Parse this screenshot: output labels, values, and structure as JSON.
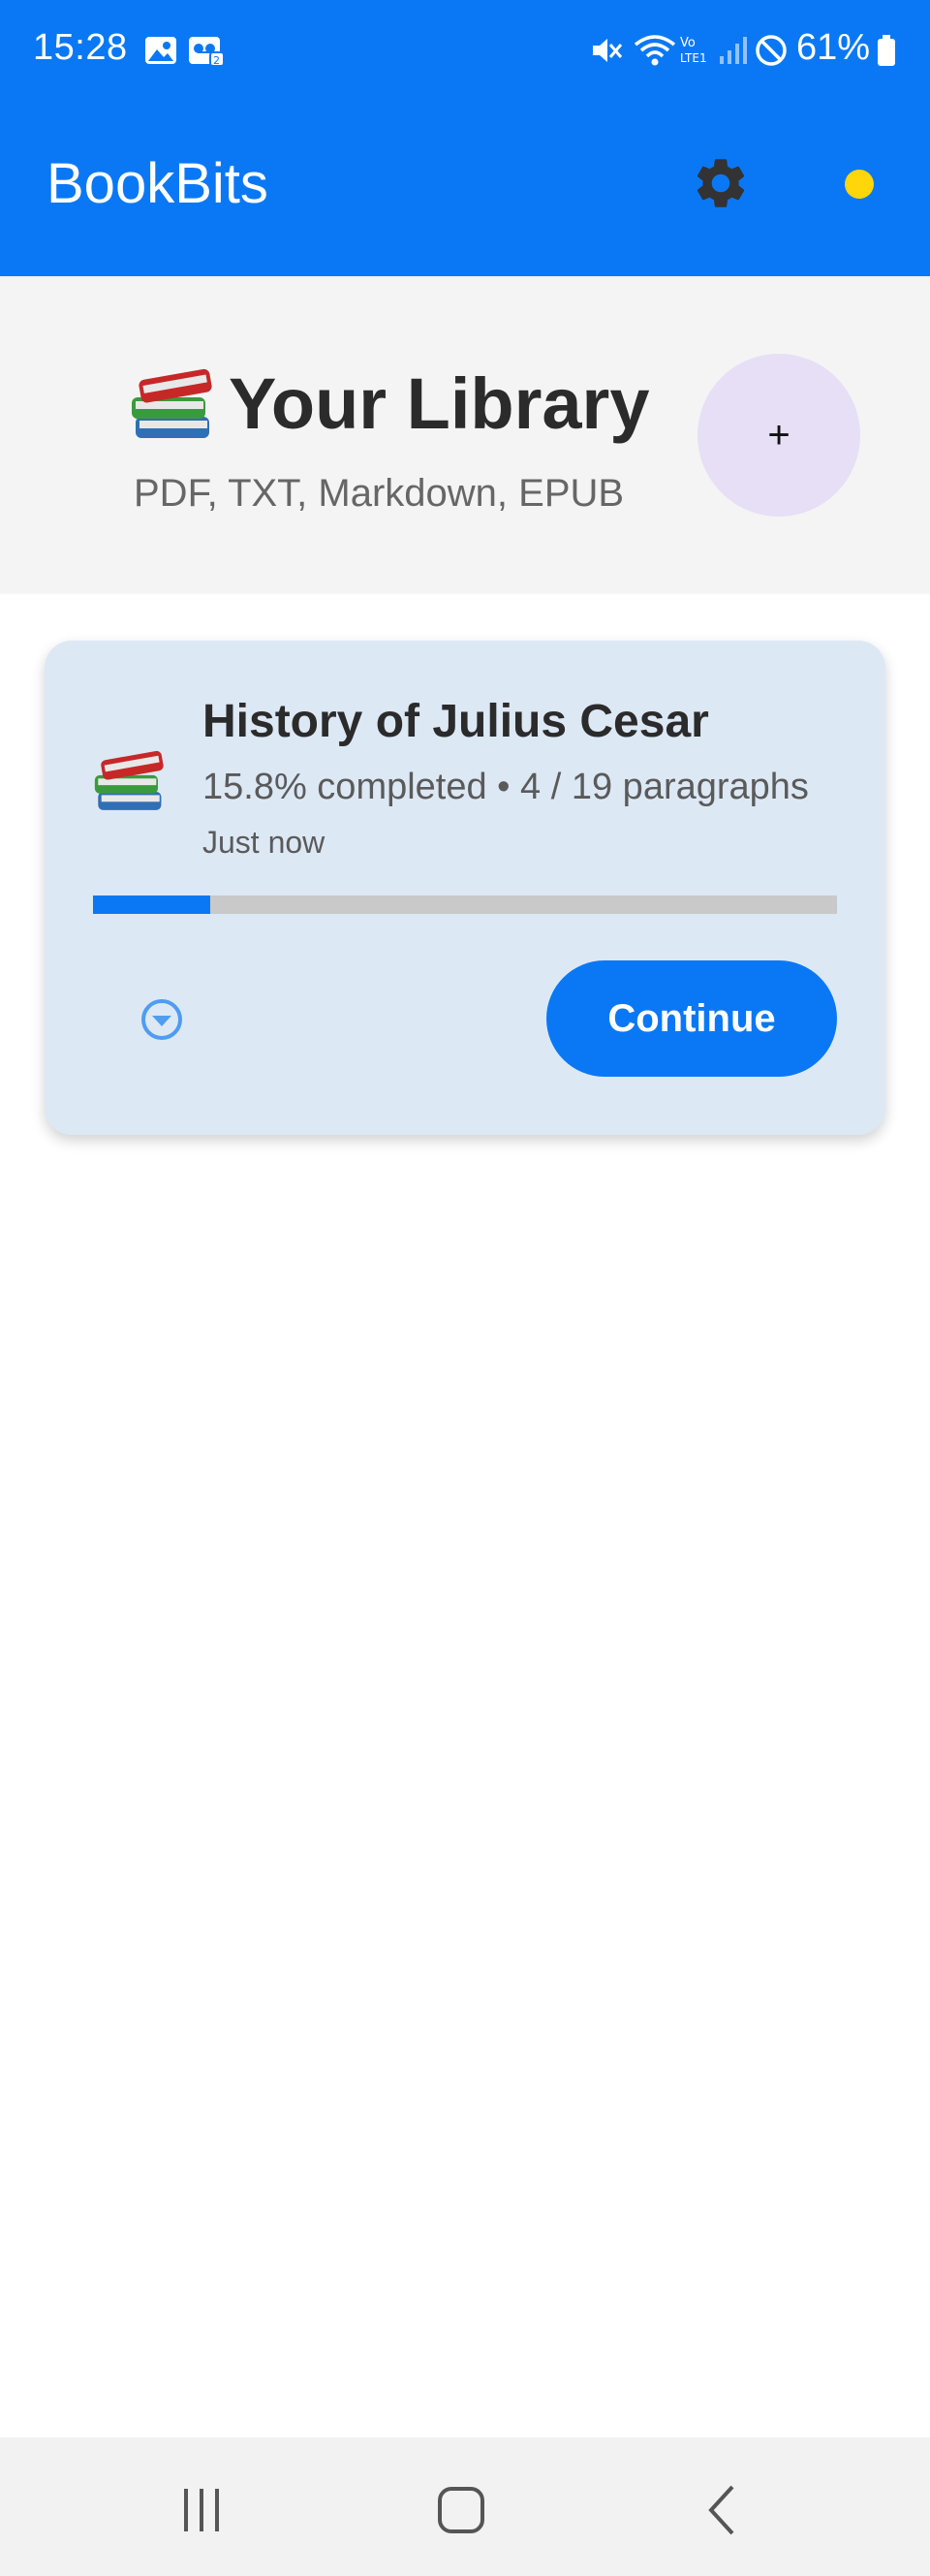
{
  "status_bar": {
    "time": "15:28",
    "battery": "61%",
    "icons": [
      "image-icon",
      "voicemail-icon",
      "mute-icon",
      "wifi-icon",
      "volte-icon",
      "signal-icon",
      "dnd-icon",
      "battery-icon"
    ]
  },
  "app_bar": {
    "title": "BookBits",
    "icons": [
      "gear-icon",
      "status-dot"
    ],
    "status_dot_color": "#ffd60a"
  },
  "library": {
    "title": "Your Library",
    "subtitle": "PDF, TXT, Markdown, EPUB",
    "add_label": "+",
    "title_icon": "books-icon"
  },
  "books": [
    {
      "title": "History of Julius Cesar",
      "progress_text": "15.8% completed • 4 / 19 paragraphs",
      "last_read": "Just now",
      "progress": 0.158,
      "continue_label": "Continue",
      "icon": "books-icon"
    }
  ],
  "nav_bar": {
    "icons": [
      "recents-icon",
      "home-icon",
      "back-icon"
    ]
  },
  "colors": {
    "primary": "#0a78f5",
    "header_bg": "#f4f4f4",
    "card_bg": "#dde8f5",
    "fab_bg": "#e6dff5"
  }
}
